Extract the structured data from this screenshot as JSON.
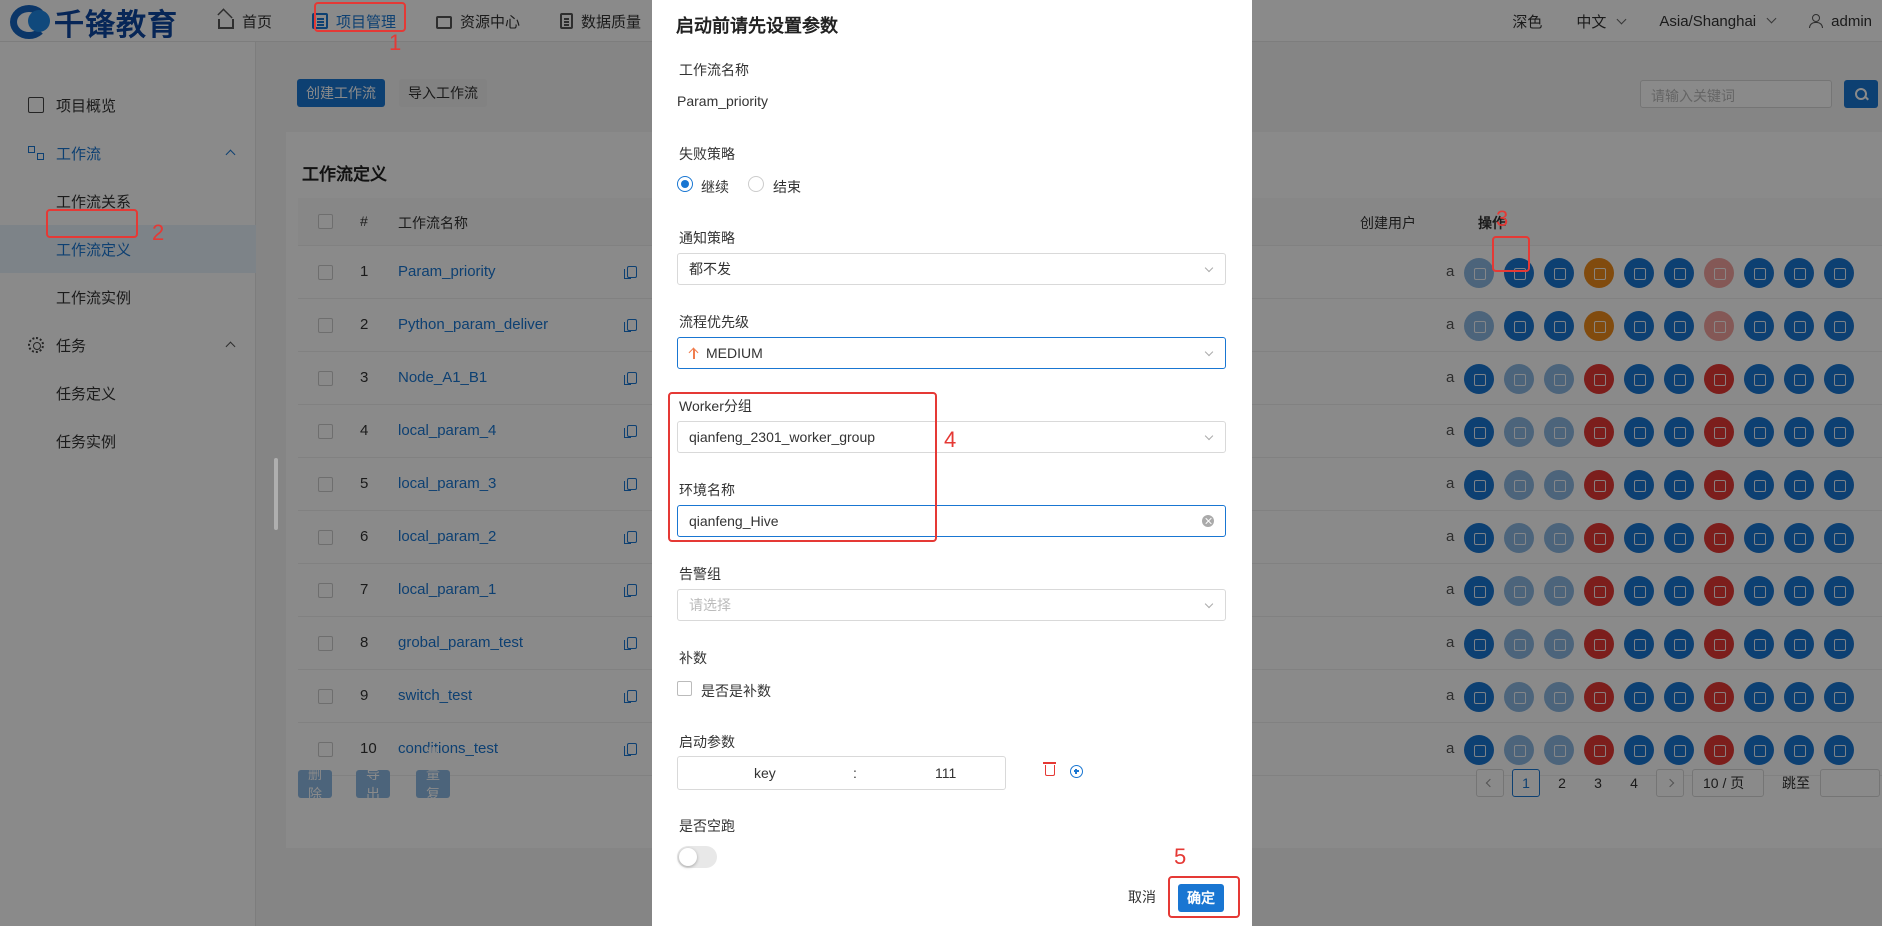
{
  "header": {
    "logo_text": "千锋教育",
    "nav": [
      {
        "label": "首页",
        "icon": "home-icon"
      },
      {
        "label": "项目管理",
        "icon": "project-icon"
      },
      {
        "label": "资源中心",
        "icon": "folder-icon"
      },
      {
        "label": "数据质量",
        "icon": "document-icon"
      }
    ],
    "theme_label": "深色",
    "language": "中文",
    "timezone": "Asia/Shanghai",
    "user": "admin"
  },
  "sidebar": {
    "items": [
      {
        "label": "项目概览",
        "icon": "monitor-icon"
      },
      {
        "label": "工作流",
        "icon": "workflow-icon"
      },
      {
        "label": "工作流关系"
      },
      {
        "label": "工作流定义"
      },
      {
        "label": "工作流实例"
      },
      {
        "label": "任务",
        "icon": "gear-icon"
      },
      {
        "label": "任务定义"
      },
      {
        "label": "任务实例"
      }
    ]
  },
  "toolbar": {
    "create_label": "创建工作流",
    "import_label": "导入工作流",
    "search_placeholder": "请输入关键词"
  },
  "card": {
    "title": "工作流定义"
  },
  "table": {
    "headers": {
      "index": "#",
      "name": "工作流名称",
      "create_user": "创建用户",
      "ops": "操作"
    },
    "rows": [
      {
        "index": "1",
        "name": "Param_priority",
        "trail": "a"
      },
      {
        "index": "2",
        "name": "Python_param_deliver",
        "trail": "a"
      },
      {
        "index": "3",
        "name": "Node_A1_B1",
        "trail": "a"
      },
      {
        "index": "4",
        "name": "local_param_4",
        "trail": "a"
      },
      {
        "index": "5",
        "name": "local_param_3",
        "trail": "a"
      },
      {
        "index": "6",
        "name": "local_param_2",
        "trail": "a"
      },
      {
        "index": "7",
        "name": "local_param_1",
        "trail": "a"
      },
      {
        "index": "8",
        "name": "grobal_param_test",
        "trail": "a"
      },
      {
        "index": "9",
        "name": "switch_test",
        "trail": "a"
      },
      {
        "index": "10",
        "name": "conditions_test",
        "trail": "a"
      }
    ]
  },
  "footer": {
    "delete_label": "删除",
    "export_label": "导出",
    "batch_copy_label": "批量复制"
  },
  "pagination": {
    "pages": [
      "1",
      "2",
      "3",
      "4"
    ],
    "current": "1",
    "page_size": "10 / 页",
    "jump_label": "跳至"
  },
  "modal": {
    "title": "启动前请先设置参数",
    "workflow_name_label": "工作流名称",
    "workflow_name": "Param_priority",
    "failure_strategy_label": "失败策略",
    "failure_options": [
      "继续",
      "结束"
    ],
    "failure_selected": "继续",
    "notify_strategy_label": "通知策略",
    "notify_strategy": "都不发",
    "priority_label": "流程优先级",
    "priority": "MEDIUM",
    "worker_group_label": "Worker分组",
    "worker_group": "qianfeng_2301_worker_group",
    "env_label": "环境名称",
    "env": "qianfeng_Hive",
    "alert_group_label": "告警组",
    "alert_group_placeholder": "请选择",
    "complement_label": "补数",
    "complement_checkbox": "是否是补数",
    "startup_params_label": "启动参数",
    "param_key": "key",
    "param_sep": ":",
    "param_value": "111",
    "dry_run_label": "是否空跑",
    "cancel_label": "取消",
    "confirm_label": "确定"
  },
  "annotations": [
    "1",
    "2",
    "3",
    "4",
    "5"
  ],
  "colors": {
    "primary": "#1976d2",
    "annotation_red": "#e53935",
    "danger": "#e53935",
    "warning": "#ef8b1a"
  }
}
